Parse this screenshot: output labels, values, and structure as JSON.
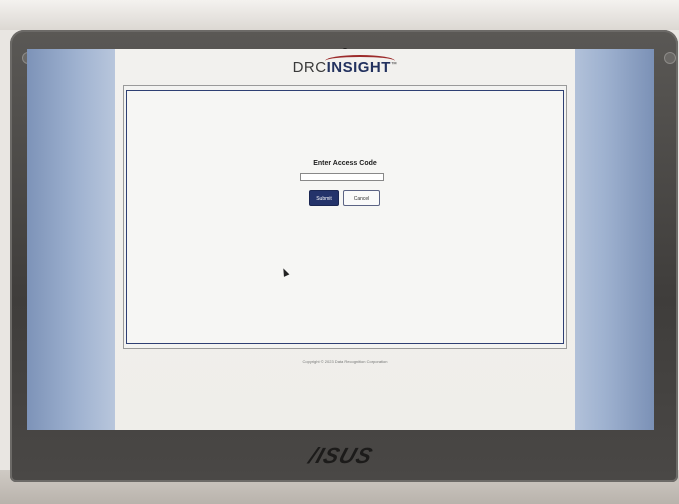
{
  "app": {
    "logo_prefix": "DRC",
    "logo_brand": "INSIGHT",
    "logo_mark": "™"
  },
  "form": {
    "title": "Enter Access Code",
    "access_code_value": "",
    "submit_label": "Submit",
    "cancel_label": "Cancel"
  },
  "footer": {
    "copyright": "Copyright © 2023 Data Recognition Corporation"
  },
  "device": {
    "brand": "/ISUS"
  },
  "colors": {
    "primary_button": "#24336a",
    "frame_border": "#2e3f73",
    "logo_accent": "#9c2b2b"
  },
  "icons": {
    "cursor": "mouse-pointer-icon"
  }
}
